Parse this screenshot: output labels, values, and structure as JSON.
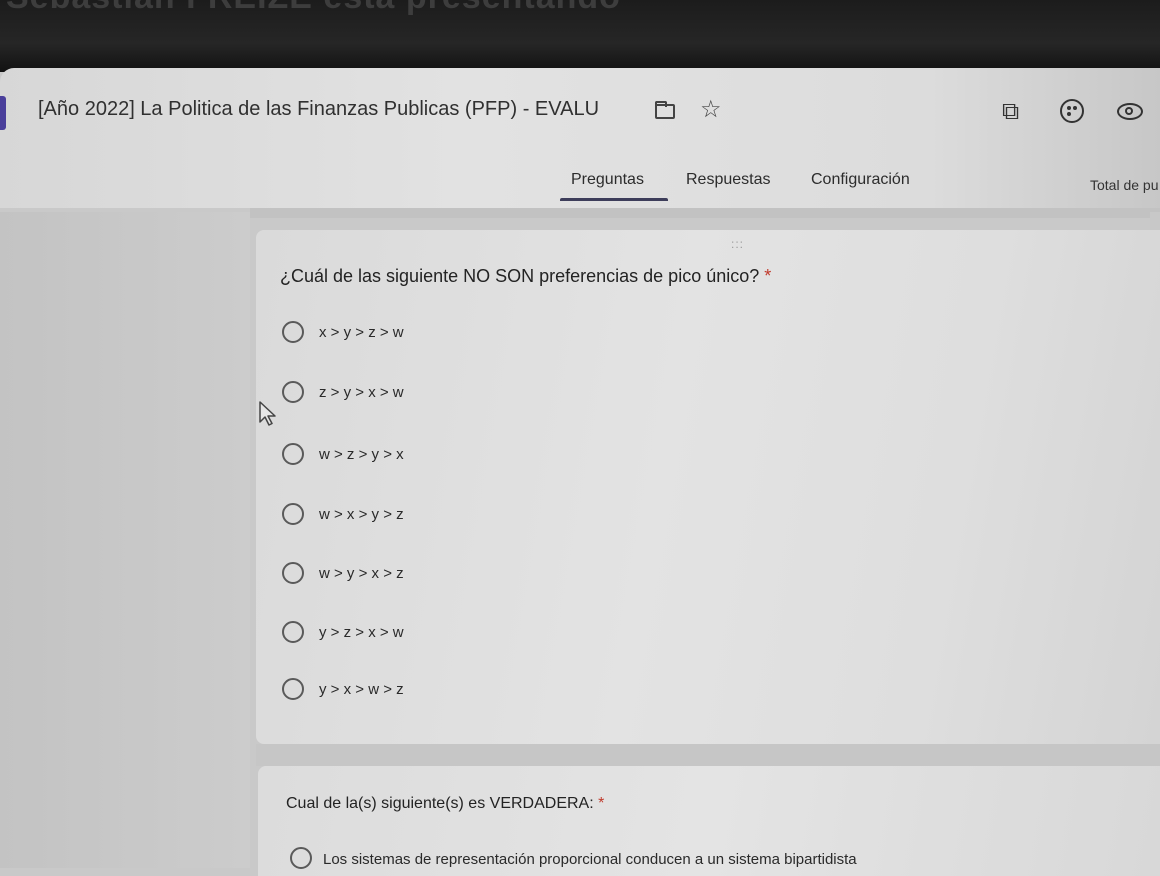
{
  "banner": {
    "presenter_text": "Sebastian FREIZE está presentando"
  },
  "header": {
    "title": "[Año 2022] La Politica de las Finanzas Publicas (PFP) - EVALU",
    "icons": [
      "folder-icon",
      "star-icon",
      "addon-icon",
      "palette-icon",
      "eye-icon"
    ]
  },
  "tabs": [
    {
      "label": "Preguntas",
      "active": true
    },
    {
      "label": "Respuestas",
      "active": false
    },
    {
      "label": "Configuración",
      "active": false
    }
  ],
  "total_label": "Total de pu",
  "question1": {
    "drag_handle": ":::",
    "title": "¿Cuál de las siguiente NO SON preferencias de pico único?",
    "required_mark": "*",
    "options": [
      {
        "label": "x > y > z > w"
      },
      {
        "label": "z > y > x > w"
      },
      {
        "label": "w > z > y > x"
      },
      {
        "label": "w > x > y > z"
      },
      {
        "label": "w > y > x > z"
      },
      {
        "label": "y > z > x > w"
      },
      {
        "label": "y > x > w > z"
      }
    ]
  },
  "question2": {
    "title": "Cual de la(s) siguiente(s) es VERDADERA:",
    "required_mark": "*",
    "options": [
      {
        "label": "Los sistemas de representación proporcional conducen a un sistema bipartidista"
      }
    ]
  },
  "colors": {
    "required": "#c0392b",
    "accent": "#4a3f9b"
  }
}
